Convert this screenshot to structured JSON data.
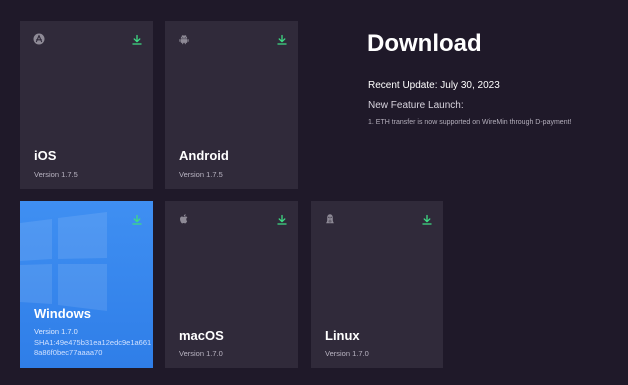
{
  "header": {
    "title": "Download",
    "recent_update": "Recent Update: July 30, 2023",
    "feature_title": "New Feature Launch:",
    "feature_items": [
      "1. ETH transfer is now supported on WireMin through D-payment!"
    ]
  },
  "cards": {
    "ios": {
      "name": "iOS",
      "version": "Version 1.7.5",
      "icon": "app-store-icon"
    },
    "android": {
      "name": "Android",
      "version": "Version 1.7.5",
      "icon": "android-icon"
    },
    "windows": {
      "name": "Windows",
      "version": "Version 1.7.0",
      "sha": "SHA1:49e475b31ea12edc9e1a6618a86f0bec77aaaa70",
      "icon": "windows-icon"
    },
    "macos": {
      "name": "macOS",
      "version": "Version 1.7.0",
      "icon": "apple-icon"
    },
    "linux": {
      "name": "Linux",
      "version": "Version 1.7.0",
      "icon": "linux-icon"
    }
  },
  "colors": {
    "background": "#1f1929",
    "card": "#302a3a",
    "active_card": "#3a8af0",
    "download_accent": "#3ddc84"
  }
}
